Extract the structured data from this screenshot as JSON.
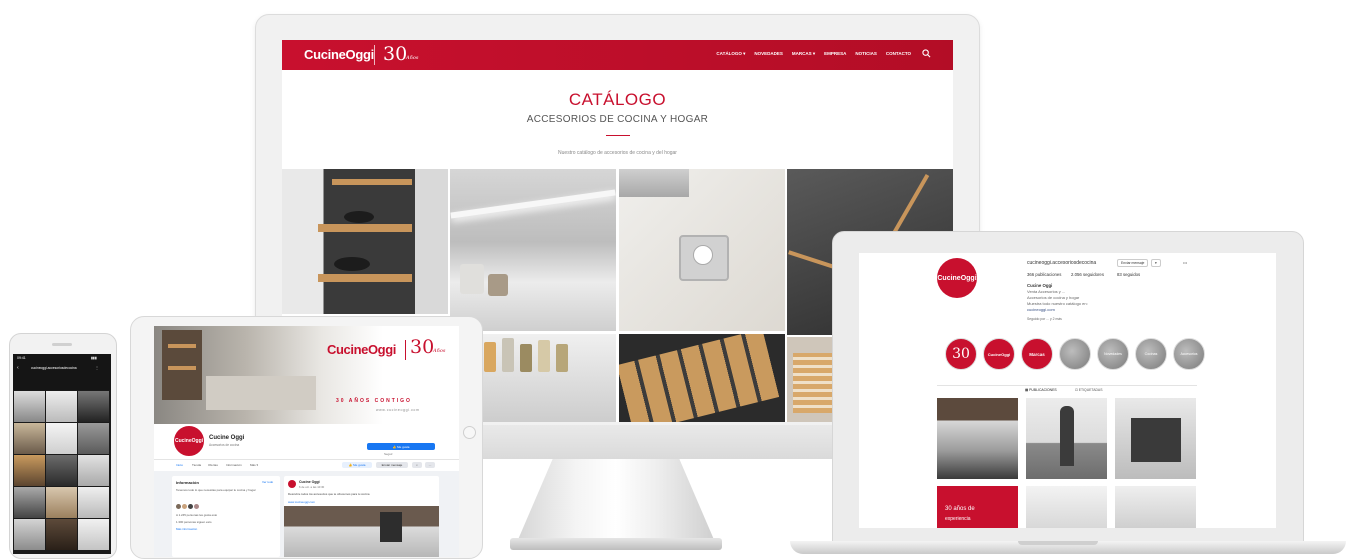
{
  "brand": {
    "name": "CucineOggi",
    "years": "30",
    "years_word": "Años",
    "accent": "#c8102e"
  },
  "site": {
    "nav": [
      "CATÁLOGO ▾",
      "NOVEDADES",
      "MARCAS ▾",
      "EMPRESA",
      "NOTICIAS",
      "CONTACTO"
    ],
    "title": "CATÁLOGO",
    "subtitle": "ACCESORIOS DE COCINA Y HOGAR",
    "description": "Nuestro catálogo de accesorios de cocina y del hogar"
  },
  "instagram": {
    "username": "cucineoggi.accesoriosdecocina",
    "follow_label": "Enviar mensaje",
    "follow_more": "▾",
    "stats": [
      "366 publicaciones",
      "2.056 seguidores",
      "83 seguidos"
    ],
    "bio": [
      "Cucine Oggi",
      "Venta Accesorios y ...",
      "Accesorios de cocina y hogar",
      "Muestra todo nuestro catálogo en:",
      "cucineoggi.com"
    ],
    "followed_by": "Seguido por ... y 2 más",
    "highlights": [
      "30",
      "CucineOggi",
      "Marcas",
      "",
      "Novedades",
      "Cocinas",
      "Accesorios"
    ],
    "tabs": [
      "▦ PUBLICACIONES",
      "⊡ ETIQUETADAS"
    ],
    "promo": "30 años de",
    "promo_2": "experiencia"
  },
  "facebook": {
    "page_name": "Cucine Oggi",
    "category": "Accesorios de cocina",
    "cover_slogan": "30 AÑOS CONTIGO",
    "cover_url": "www.cucineoggi.com",
    "like_button": "👍 Me gusta",
    "message_button": "Enviar mensaje",
    "follow_label": "Seguir",
    "tabs": [
      "Inicio",
      "Tienda",
      "Ofertas",
      "Información",
      "Más ▾"
    ],
    "info_title": "Información",
    "info_more": "Ver todo",
    "info_text": "Tenemos todo lo que necesitas para equipar tu cocina y hogar",
    "info_rows": [
      "A 1.245 personas les gusta esto",
      "1.300 personas siguen esto",
      "Más información"
    ],
    "post_author": "Cucine Oggi",
    "post_time": "6 de oct. a las 10:30",
    "post_text": "Descubre todos los accesorios que te ofrecemos para tu cocina",
    "post_link": "www.cucineoggi.com"
  },
  "phone": {
    "status_time": "09:41",
    "account": "cucineoggi.accesoriosdecocina"
  }
}
